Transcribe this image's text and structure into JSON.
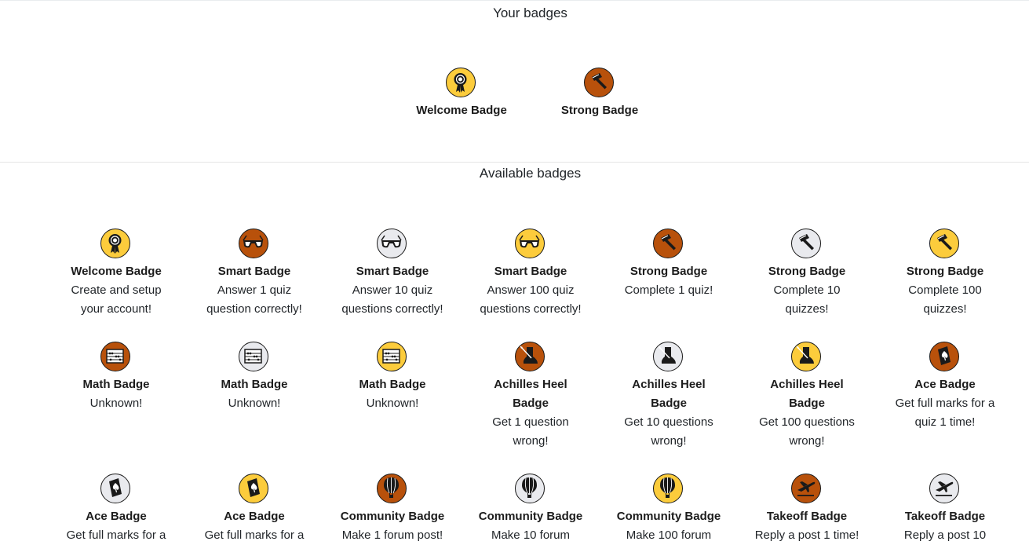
{
  "your_badges": {
    "title": "Your badges",
    "items": [
      {
        "name": "Welcome Badge",
        "icon": "ribbon-award-icon",
        "tier": "gold"
      },
      {
        "name": "Strong Badge",
        "icon": "hammer-icon",
        "tier": "bronze"
      }
    ]
  },
  "available_badges": {
    "title": "Available badges",
    "rows": [
      [
        {
          "name": "Welcome Badge",
          "desc": [
            "Create and setup",
            "your account!"
          ],
          "icon": "ribbon-award-icon",
          "tier": "gold"
        },
        {
          "name": "Smart Badge",
          "desc": [
            "Answer 1 quiz",
            "question correctly!"
          ],
          "icon": "glasses-icon",
          "tier": "bronze"
        },
        {
          "name": "Smart Badge",
          "desc": [
            "Answer 10 quiz",
            "questions correctly!"
          ],
          "icon": "glasses-icon",
          "tier": "silver"
        },
        {
          "name": "Smart Badge",
          "desc": [
            "Answer 100 quiz",
            "questions correctly!"
          ],
          "icon": "glasses-icon",
          "tier": "gold"
        },
        {
          "name": "Strong Badge",
          "desc": [
            "Complete 1 quiz!"
          ],
          "icon": "hammer-icon",
          "tier": "bronze"
        },
        {
          "name": "Strong Badge",
          "desc": [
            "Complete 10",
            "quizzes!"
          ],
          "icon": "hammer-icon",
          "tier": "silver"
        },
        {
          "name": "Strong Badge",
          "desc": [
            "Complete 100",
            "quizzes!"
          ],
          "icon": "hammer-icon",
          "tier": "gold"
        }
      ],
      [
        {
          "name": "Math Badge",
          "desc": [
            "Unknown!"
          ],
          "icon": "abacus-icon",
          "tier": "bronze"
        },
        {
          "name": "Math Badge",
          "desc": [
            "Unknown!"
          ],
          "icon": "abacus-icon",
          "tier": "silver"
        },
        {
          "name": "Math Badge",
          "desc": [
            "Unknown!"
          ],
          "icon": "abacus-icon",
          "tier": "gold"
        },
        {
          "name": "Achilles Heel Badge",
          "desc": [
            "Get 1 question",
            "wrong!"
          ],
          "icon": "heel-arrow-icon",
          "tier": "bronze"
        },
        {
          "name": "Achilles Heel Badge",
          "desc": [
            "Get 10 questions",
            "wrong!"
          ],
          "icon": "heel-arrow-icon",
          "tier": "silver"
        },
        {
          "name": "Achilles Heel Badge",
          "desc": [
            "Get 100 questions",
            "wrong!"
          ],
          "icon": "heel-arrow-icon",
          "tier": "gold"
        },
        {
          "name": "Ace Badge",
          "desc": [
            "Get full marks for a",
            "quiz 1 time!"
          ],
          "icon": "ace-card-icon",
          "tier": "bronze"
        }
      ],
      [
        {
          "name": "Ace Badge",
          "desc": [
            "Get full marks for a"
          ],
          "icon": "ace-card-icon",
          "tier": "silver"
        },
        {
          "name": "Ace Badge",
          "desc": [
            "Get full marks for a"
          ],
          "icon": "ace-card-icon",
          "tier": "gold"
        },
        {
          "name": "Community Badge",
          "desc": [
            "Make 1 forum post!"
          ],
          "icon": "hot-air-balloon-icon",
          "tier": "bronze"
        },
        {
          "name": "Community Badge",
          "desc": [
            "Make 10 forum"
          ],
          "icon": "hot-air-balloon-icon",
          "tier": "silver"
        },
        {
          "name": "Community Badge",
          "desc": [
            "Make 100 forum"
          ],
          "icon": "hot-air-balloon-icon",
          "tier": "gold"
        },
        {
          "name": "Takeoff Badge",
          "desc": [
            "Reply a post 1 time!"
          ],
          "icon": "airplane-takeoff-icon",
          "tier": "bronze"
        },
        {
          "name": "Takeoff Badge",
          "desc": [
            "Reply a post 10"
          ],
          "icon": "airplane-takeoff-icon",
          "tier": "silver"
        }
      ]
    ]
  },
  "colors": {
    "gold": "#fccc3c",
    "bronze": "#b8510b",
    "silver": "#e9eaee",
    "text": "#212529",
    "divider": "#e6e6e6"
  }
}
